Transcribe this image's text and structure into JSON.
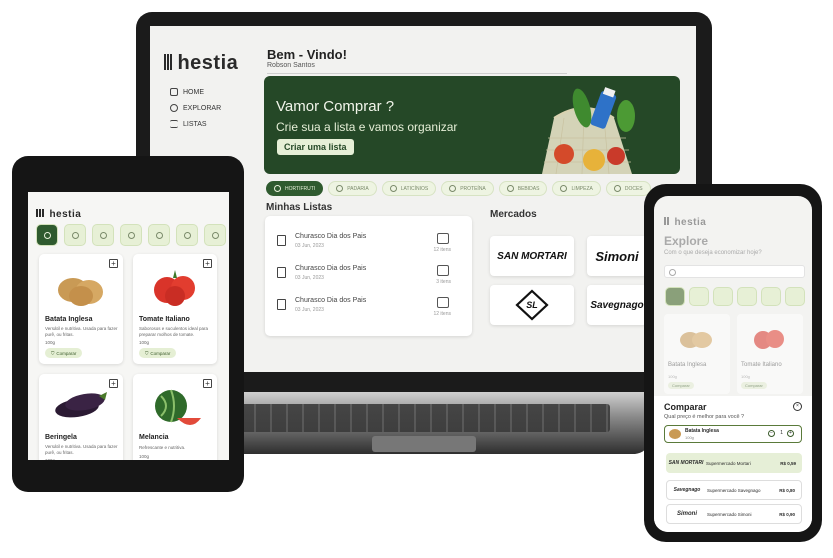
{
  "colors": {
    "brand_green": "#254827",
    "accent_light": "#e6efd7",
    "text_dark": "#2b2b2b"
  },
  "laptop": {
    "logo": "hestia",
    "nav": [
      {
        "label": "HOME",
        "icon": "home-icon"
      },
      {
        "label": "EXPLORAR",
        "icon": "search-icon"
      },
      {
        "label": "LISTAS",
        "icon": "list-icon"
      }
    ],
    "greeting": "Bem - Vindo!",
    "user": "Robson Santos",
    "banner": {
      "title": "Vamor Comprar ?",
      "subtitle": "Crie sua a lista e vamos organizar",
      "button": "Criar uma lista"
    },
    "categories": [
      "HORTIFRUTI",
      "PADARIA",
      "LATICÍNIOS",
      "PROTEÍNA",
      "BEBIDAS",
      "LIMPEZA",
      "DOCES"
    ],
    "lists_title": "Minhas Listas",
    "lists": [
      {
        "name": "Churasco Dia dos Pais",
        "date": "03 Jun, 2023",
        "items": "12 itens"
      },
      {
        "name": "Churasco Dia dos Pais",
        "date": "03 Jun, 2023",
        "items": "3 itens"
      },
      {
        "name": "Churasco Dia dos Pais",
        "date": "03 Jun, 2023",
        "items": "12 itens"
      }
    ],
    "markets_title": "Mercados",
    "markets": [
      "SAN MORTARI",
      "Simoni",
      "SL",
      "Savegnago"
    ]
  },
  "tablet": {
    "logo": "hestia",
    "products": [
      {
        "name": "Batata Inglesa",
        "desc": "Versátil e nutritiva. Usada para fazer purê, ou fritas.",
        "weight": "100g",
        "button": "Comparar"
      },
      {
        "name": "Tomate Italiano",
        "desc": "Saborosos e suculentos ideal para preparar molhos de tomate.",
        "weight": "100g",
        "button": "Comparar"
      },
      {
        "name": "Beringela",
        "desc": "Versátil e nutritiva. Usada para fazer purê, ou fritas.",
        "weight": "100g"
      },
      {
        "name": "Melancia",
        "desc": "Refrescante e nutritiva.",
        "weight": "100g"
      }
    ]
  },
  "phone": {
    "logo": "hestia",
    "title": "Explore",
    "subtitle": "Com o que deseja economizar hoje?",
    "search_placeholder": "",
    "products": [
      {
        "name": "Batata Inglesa",
        "weight": "100g",
        "button": "Comparar"
      },
      {
        "name": "Tomate Italiano",
        "weight": "100g",
        "button": "Comparar"
      }
    ],
    "compare": {
      "title": "Comparar",
      "question": "Qual preço é melhor para você ?",
      "item_name": "Batata Inglesa",
      "item_weight": "100g",
      "quantity": "1",
      "markets": [
        {
          "logo": "SAN MORTARI",
          "name": "Supermercado Mortari",
          "price": "R$ 0,59"
        },
        {
          "logo": "Savegnago",
          "name": "Supermercado Savegnago",
          "price": "R$ 0,80"
        },
        {
          "logo": "Simoni",
          "name": "Supermercado Simoni",
          "price": "R$ 0,90"
        }
      ]
    }
  }
}
